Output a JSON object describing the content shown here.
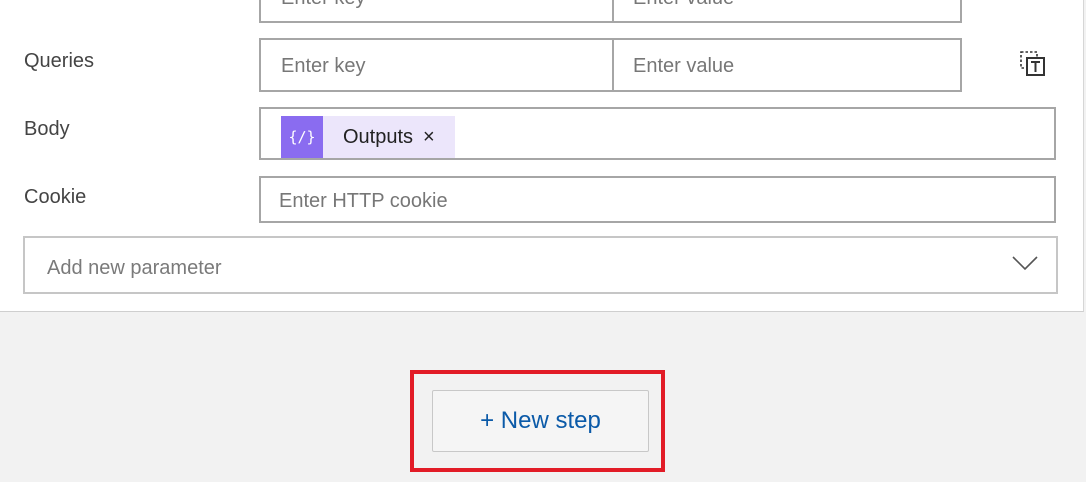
{
  "form": {
    "headers_row": {
      "key_placeholder": "Enter key",
      "value_placeholder": "Enter value"
    },
    "queries": {
      "label": "Queries",
      "key_placeholder": "Enter key",
      "value_placeholder": "Enter value",
      "delete_icon": "delete-row-icon"
    },
    "body": {
      "label": "Body",
      "token": {
        "label": "Outputs",
        "icon": "expression-icon",
        "icon_glyph": "{∕}",
        "remove": "×",
        "color": "#8a6cf0"
      }
    },
    "cookie": {
      "label": "Cookie",
      "placeholder": "Enter HTTP cookie"
    },
    "add_parameter": {
      "placeholder": "Add new parameter",
      "icon": "chevron-down-icon"
    }
  },
  "actions": {
    "new_step_label": "+ New step",
    "highlight_color": "#e21c27",
    "link_color": "#0b5aa8"
  }
}
